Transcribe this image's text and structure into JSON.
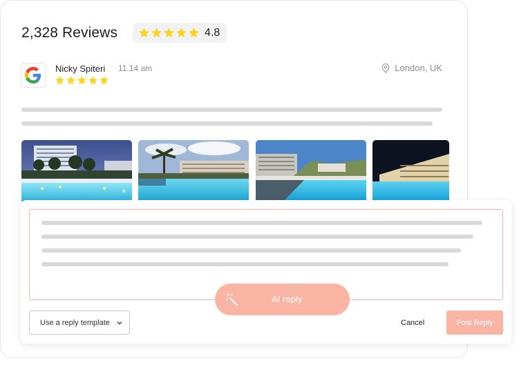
{
  "header": {
    "reviews_count": "2,328 Reviews",
    "rating": "4.8",
    "stars": 5
  },
  "review": {
    "source_icon": "google-icon",
    "reviewer_name": "Nicky Spiteri",
    "time": "11.14 am",
    "stars": 5,
    "location_icon": "map-pin-icon",
    "location": "London, UK",
    "photos": [
      "hotel-night-pool",
      "hotel-palm-pool",
      "resort-sunbed-pool",
      "pool-night-lights"
    ]
  },
  "reply": {
    "ai_button_label": "AI reply",
    "ai_icon": "magic-wand-icon",
    "template_select": "Use a reply template",
    "cancel_label": "Cancel",
    "post_label": "Post Reply"
  },
  "colors": {
    "star": "#FFD21F",
    "accent": "#FAB4A3",
    "reply_border": "#F3B3A6",
    "placeholder_line": "#D9D9D9"
  }
}
